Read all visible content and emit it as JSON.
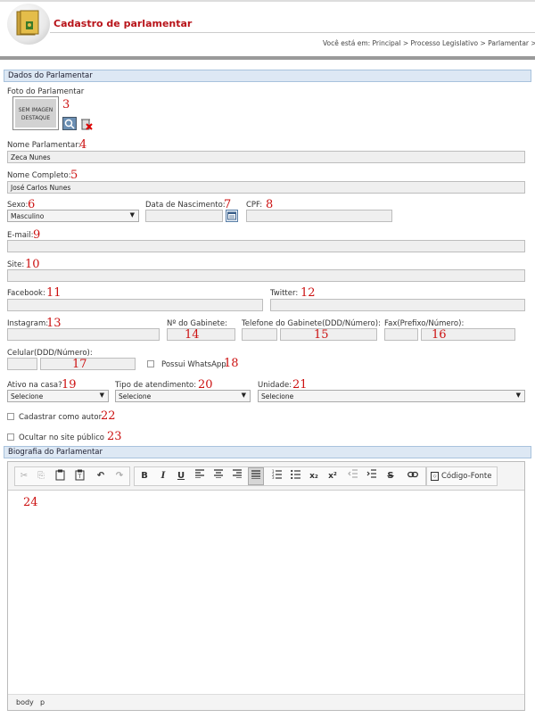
{
  "header": {
    "title": "Cadastro de parlamentar",
    "breadcrumb": "Você está em: Principal > Processo Legislativo > Parlamentar > Incluir"
  },
  "section1": {
    "title": "Dados do Parlamentar"
  },
  "photo": {
    "label": "Foto do Parlamentar",
    "placeholder_line1": "SEM IMAGEN",
    "placeholder_line2": "DESTAQUE",
    "marker": "3"
  },
  "fields": {
    "nome_parlamentar": {
      "label": "Nome Parlamentar:",
      "value": "Zeca Nunes",
      "marker": "4"
    },
    "nome_completo": {
      "label": "Nome Completo:",
      "value": "José Carlos Nunes",
      "marker": "5"
    },
    "sexo": {
      "label": "Sexo:",
      "value": "Masculino",
      "marker": "6"
    },
    "data_nascimento": {
      "label": "Data de Nascimento:",
      "value": "",
      "marker": "7"
    },
    "cpf": {
      "label": "CPF:",
      "value": "",
      "marker": "8"
    },
    "email": {
      "label": "E-mail:",
      "value": "",
      "marker": "9"
    },
    "site": {
      "label": "Site:",
      "value": "",
      "marker": "10"
    },
    "facebook": {
      "label": "Facebook:",
      "value": "",
      "marker": "11"
    },
    "twitter": {
      "label": "Twitter:",
      "value": "",
      "marker": "12"
    },
    "instagram": {
      "label": "Instagram:",
      "value": "",
      "marker": "13"
    },
    "gabinete": {
      "label": "Nº do Gabinete:",
      "value": "",
      "marker": "14"
    },
    "telefone": {
      "label": "Telefone do Gabinete(DDD/Número):",
      "value": "",
      "marker": "15"
    },
    "fax": {
      "label": "Fax(Prefixo/Número):",
      "value": "",
      "marker": "16"
    },
    "celular": {
      "label": "Celular(DDD/Número):",
      "value": "",
      "marker": "17"
    },
    "whatsapp": {
      "label": "Possui WhatsApp",
      "marker": "18"
    },
    "ativo": {
      "label": "Ativo na casa?",
      "value": "Selecione",
      "marker": "19"
    },
    "tipo_atendimento": {
      "label": "Tipo de atendimento:",
      "value": "Selecione",
      "marker": "20"
    },
    "unidade": {
      "label": "Unidade:",
      "value": "Selecione",
      "marker": "21"
    },
    "cadastrar_autor": {
      "label": "Cadastrar como autor",
      "marker": "22"
    },
    "ocultar_site": {
      "label": "Ocultar no site público",
      "marker": "23"
    }
  },
  "section2": {
    "title": "Biografia do Parlamentar"
  },
  "editor": {
    "source_label": "Código-Fonte",
    "content_marker": "24",
    "path_body": "body",
    "path_p": "p"
  },
  "icons": {
    "cut": "✂",
    "copy": "⎘",
    "paste": "📋",
    "paste_text": "📄",
    "undo": "↶",
    "redo": "↷",
    "bold": "B",
    "italic": "I",
    "underline": "U",
    "subscript": "x₂",
    "superscript": "x²",
    "strike": "S"
  }
}
